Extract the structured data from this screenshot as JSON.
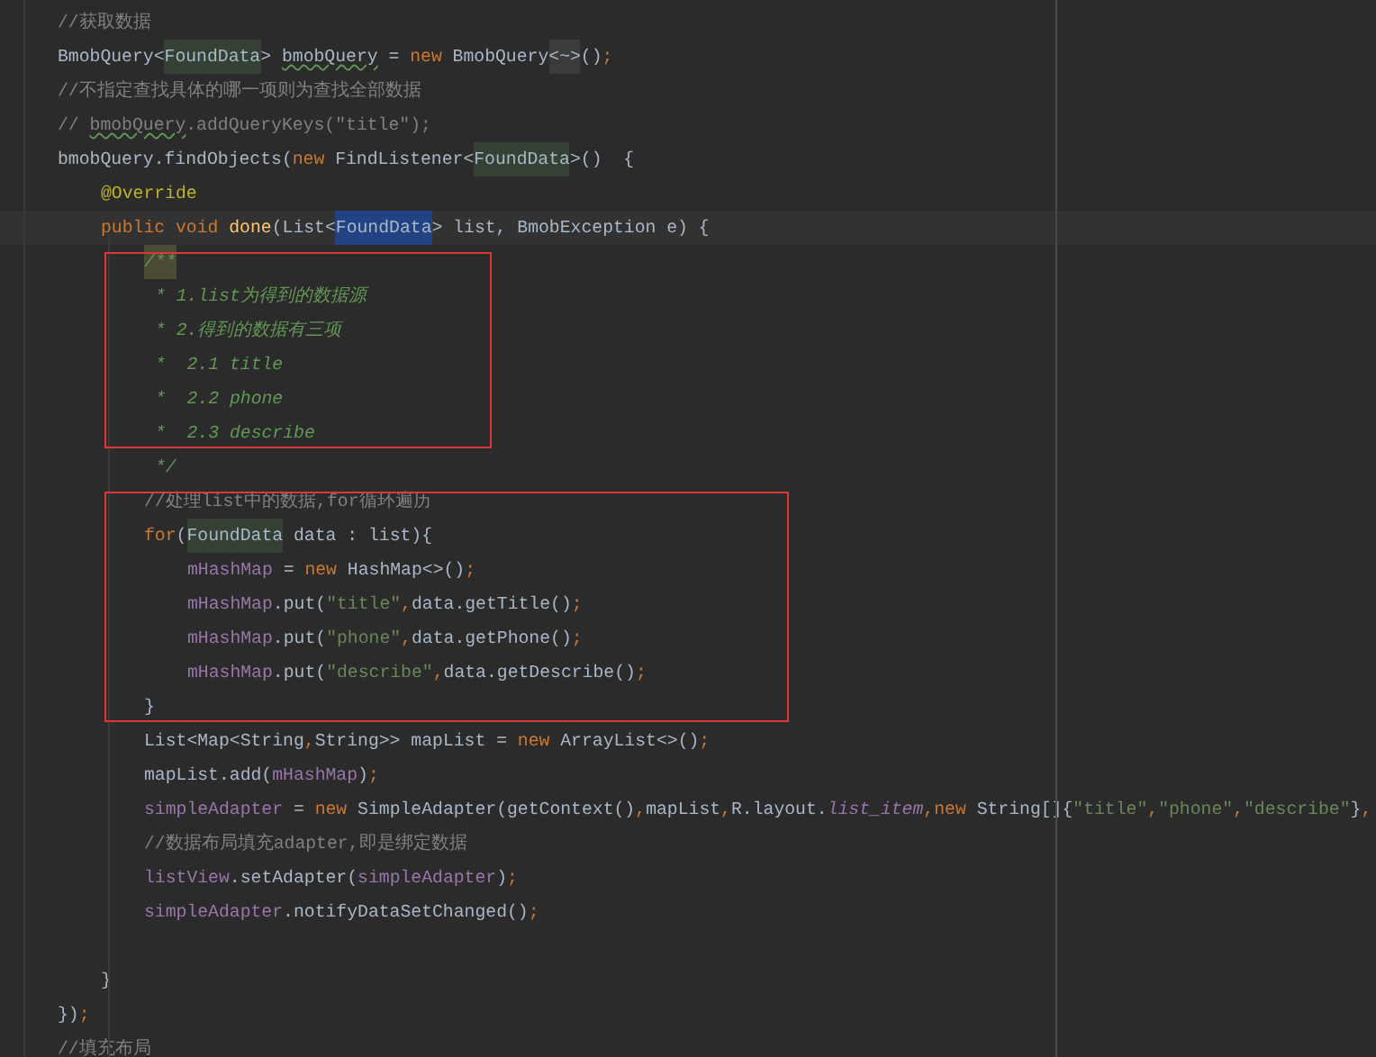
{
  "editor": {
    "lines": [
      {
        "kind": "line",
        "tokens": [
          {
            "text": "//获取数据",
            "kind": "comment"
          }
        ]
      },
      {
        "kind": "line",
        "tokens": [
          {
            "text": "BmobQuery<",
            "kind": "plain"
          },
          {
            "text": "FoundData",
            "kind": "type_usage"
          },
          {
            "text": "> ",
            "kind": "plain"
          },
          {
            "text": "bmobQuery",
            "kind": "warn"
          },
          {
            "text": " = ",
            "kind": "plain"
          },
          {
            "text": "new",
            "kind": "keyword"
          },
          {
            "text": " BmobQuery",
            "kind": "plain"
          },
          {
            "text": "<~>",
            "kind": "folded"
          },
          {
            "text": "()",
            "kind": "plain"
          },
          {
            "text": ";",
            "kind": "keyword"
          }
        ]
      },
      {
        "kind": "line",
        "tokens": [
          {
            "text": "//不指定查找具体的哪一项则为查找全部数据",
            "kind": "comment"
          }
        ]
      },
      {
        "kind": "line",
        "tokens": [
          {
            "text": "// ",
            "kind": "comment"
          },
          {
            "text": "bmobQuery",
            "kind": "comment_warn"
          },
          {
            "text": ".addQueryKeys(\"title\");",
            "kind": "comment"
          }
        ]
      },
      {
        "kind": "line",
        "tokens": [
          {
            "text": "bmobQuery.findObjects(",
            "kind": "plain"
          },
          {
            "text": "new",
            "kind": "keyword"
          },
          {
            "text": " FindListener<",
            "kind": "plain"
          },
          {
            "text": "FoundData",
            "kind": "type_usage"
          },
          {
            "text": ">()  {",
            "kind": "plain"
          }
        ],
        "children": [
          {
            "kind": "line",
            "tokens": [
              {
                "text": "@Override",
                "kind": "annotation"
              }
            ]
          },
          {
            "kind": "current_line",
            "tokens": [
              {
                "text": "public void ",
                "kind": "keyword"
              },
              {
                "text": "done",
                "kind": "method"
              },
              {
                "text": "(List<",
                "kind": "plain"
              },
              {
                "text": "FoundData",
                "kind": "type_selected"
              },
              {
                "text": "> list, BmobException e) {",
                "kind": "plain"
              }
            ],
            "children": [
              {
                "kind": "box",
                "lines": [
                  {
                    "kind": "line",
                    "tokens": [
                      {
                        "text": "/**",
                        "kind": "doc_matched"
                      }
                    ]
                  },
                  {
                    "kind": "doc_line",
                    "tokens": [
                      {
                        "text": "* 1.list为得到的数据源",
                        "kind": "doc"
                      }
                    ]
                  },
                  {
                    "kind": "doc_line",
                    "tokens": [
                      {
                        "text": "* 2.得到的数据有三项",
                        "kind": "doc"
                      }
                    ]
                  },
                  {
                    "kind": "doc_line",
                    "tokens": [
                      {
                        "text": "*  2.1 title",
                        "kind": "doc"
                      }
                    ]
                  },
                  {
                    "kind": "doc_line",
                    "tokens": [
                      {
                        "text": "*  2.2 phone",
                        "kind": "doc"
                      }
                    ]
                  },
                  {
                    "kind": "doc_line",
                    "tokens": [
                      {
                        "text": "*  2.3 describe",
                        "kind": "doc"
                      }
                    ]
                  }
                ]
              },
              {
                "kind": "doc_line",
                "tokens": [
                  {
                    "text": "*/",
                    "kind": "doc"
                  }
                ]
              },
              {
                "kind": "box",
                "lines": [
                  {
                    "kind": "line",
                    "tokens": [
                      {
                        "text": "//处理list中的数据,for循环遍历",
                        "kind": "comment"
                      }
                    ]
                  },
                  {
                    "kind": "line",
                    "tokens": [
                      {
                        "text": "for",
                        "kind": "keyword"
                      },
                      {
                        "text": "(",
                        "kind": "plain"
                      },
                      {
                        "text": "FoundData",
                        "kind": "type_usage"
                      },
                      {
                        "text": " data : list){",
                        "kind": "plain"
                      }
                    ],
                    "children": [
                      {
                        "kind": "line",
                        "tokens": [
                          {
                            "text": "mHashMap",
                            "kind": "field"
                          },
                          {
                            "text": " = ",
                            "kind": "plain"
                          },
                          {
                            "text": "new",
                            "kind": "keyword"
                          },
                          {
                            "text": " HashMap<>()",
                            "kind": "plain"
                          },
                          {
                            "text": ";",
                            "kind": "keyword"
                          }
                        ]
                      },
                      {
                        "kind": "line",
                        "tokens": [
                          {
                            "text": "mHashMap",
                            "kind": "field"
                          },
                          {
                            "text": ".put(",
                            "kind": "plain"
                          },
                          {
                            "text": "\"title\"",
                            "kind": "string"
                          },
                          {
                            "text": ",",
                            "kind": "keyword"
                          },
                          {
                            "text": "data.getTitle()",
                            "kind": "plain"
                          },
                          {
                            "text": ";",
                            "kind": "keyword"
                          }
                        ]
                      },
                      {
                        "kind": "line",
                        "tokens": [
                          {
                            "text": "mHashMap",
                            "kind": "field"
                          },
                          {
                            "text": ".put(",
                            "kind": "plain"
                          },
                          {
                            "text": "\"phone\"",
                            "kind": "string"
                          },
                          {
                            "text": ",",
                            "kind": "keyword"
                          },
                          {
                            "text": "data.getPhone()",
                            "kind": "plain"
                          },
                          {
                            "text": ";",
                            "kind": "keyword"
                          }
                        ]
                      },
                      {
                        "kind": "line",
                        "tokens": [
                          {
                            "text": "mHashMap",
                            "kind": "field"
                          },
                          {
                            "text": ".put(",
                            "kind": "plain"
                          },
                          {
                            "text": "\"describe\"",
                            "kind": "string"
                          },
                          {
                            "text": ",",
                            "kind": "keyword"
                          },
                          {
                            "text": "data.getDescribe()",
                            "kind": "plain"
                          },
                          {
                            "text": ";",
                            "kind": "keyword"
                          }
                        ]
                      }
                    ]
                  },
                  {
                    "kind": "line",
                    "tokens": [
                      {
                        "text": "}",
                        "kind": "plain"
                      }
                    ]
                  }
                ]
              },
              {
                "kind": "line",
                "tokens": [
                  {
                    "text": "List<Map<String",
                    "kind": "plain"
                  },
                  {
                    "text": ",",
                    "kind": "keyword"
                  },
                  {
                    "text": "String>> mapList = ",
                    "kind": "plain"
                  },
                  {
                    "text": "new",
                    "kind": "keyword"
                  },
                  {
                    "text": " ArrayList<>()",
                    "kind": "plain"
                  },
                  {
                    "text": ";",
                    "kind": "keyword"
                  }
                ]
              },
              {
                "kind": "line",
                "tokens": [
                  {
                    "text": "mapList.add(",
                    "kind": "plain"
                  },
                  {
                    "text": "mHashMap",
                    "kind": "field"
                  },
                  {
                    "text": ")",
                    "kind": "plain"
                  },
                  {
                    "text": ";",
                    "kind": "keyword"
                  }
                ]
              },
              {
                "kind": "line",
                "tokens": [
                  {
                    "text": "simpleAdapter",
                    "kind": "field"
                  },
                  {
                    "text": " = ",
                    "kind": "plain"
                  },
                  {
                    "text": "new",
                    "kind": "keyword"
                  },
                  {
                    "text": " SimpleAdapter(getContext()",
                    "kind": "plain"
                  },
                  {
                    "text": ",",
                    "kind": "keyword"
                  },
                  {
                    "text": "mapList",
                    "kind": "plain"
                  },
                  {
                    "text": ",",
                    "kind": "keyword"
                  },
                  {
                    "text": "R.layout.",
                    "kind": "plain"
                  },
                  {
                    "text": "list_item",
                    "kind": "field_italic"
                  },
                  {
                    "text": ",",
                    "kind": "keyword"
                  },
                  {
                    "text": "new",
                    "kind": "keyword"
                  },
                  {
                    "text": " String[]{",
                    "kind": "plain"
                  },
                  {
                    "text": "\"title\"",
                    "kind": "string"
                  },
                  {
                    "text": ",",
                    "kind": "keyword"
                  },
                  {
                    "text": "\"phone\"",
                    "kind": "string"
                  },
                  {
                    "text": ",",
                    "kind": "keyword"
                  },
                  {
                    "text": "\"describe\"",
                    "kind": "string"
                  },
                  {
                    "text": "}",
                    "kind": "plain"
                  },
                  {
                    "text": ",",
                    "kind": "keyword"
                  }
                ]
              },
              {
                "kind": "line",
                "tokens": [
                  {
                    "text": "//数据布局填充adapter,即是绑定数据",
                    "kind": "comment"
                  }
                ]
              },
              {
                "kind": "line",
                "tokens": [
                  {
                    "text": "listView",
                    "kind": "field"
                  },
                  {
                    "text": ".setAdapter(",
                    "kind": "plain"
                  },
                  {
                    "text": "simpleAdapter",
                    "kind": "field"
                  },
                  {
                    "text": ")",
                    "kind": "plain"
                  },
                  {
                    "text": ";",
                    "kind": "keyword"
                  }
                ]
              },
              {
                "kind": "line",
                "tokens": [
                  {
                    "text": "simpleAdapter",
                    "kind": "field"
                  },
                  {
                    "text": ".notifyDataSetChanged()",
                    "kind": "plain"
                  },
                  {
                    "text": ";",
                    "kind": "keyword"
                  }
                ]
              },
              {
                "kind": "line"
              }
            ]
          },
          {
            "kind": "line",
            "tokens": [
              {
                "text": "}",
                "kind": "plain"
              }
            ]
          }
        ]
      },
      {
        "kind": "line",
        "tokens": [
          {
            "text": "})",
            "kind": "plain"
          },
          {
            "text": ";",
            "kind": "keyword"
          }
        ]
      },
      {
        "kind": "line",
        "tokens": [
          {
            "text": "//填充布局",
            "kind": "comment"
          }
        ]
      }
    ]
  }
}
